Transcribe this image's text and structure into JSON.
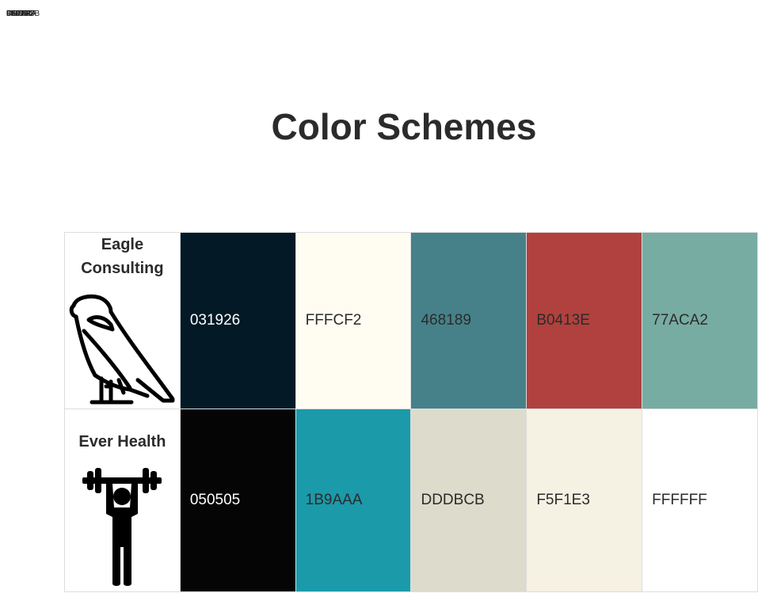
{
  "header_labels": [
    "F5F1E3",
    "FFFFFF",
    "DDDBCB",
    "1B9AAA",
    "050505",
    "031926"
  ],
  "title": "Color Schemes",
  "schemes": [
    {
      "name": "Eagle Consulting",
      "logo_icon": "eagle-icon",
      "colors": [
        {
          "hex": "031926",
          "bg": "#031926",
          "text_color": "#ffffff"
        },
        {
          "hex": "FFFCF2",
          "bg": "#FFFCF2",
          "text_color": "#2b2b2b"
        },
        {
          "hex": "468189",
          "bg": "#468189",
          "text_color": "#2b2b2b"
        },
        {
          "hex": "B0413E",
          "bg": "#B0413E",
          "text_color": "#2b2b2b"
        },
        {
          "hex": "77ACA2",
          "bg": "#77ACA2",
          "text_color": "#2b2b2b"
        }
      ]
    },
    {
      "name": "Ever Health",
      "logo_icon": "weightlifter-icon",
      "colors": [
        {
          "hex": "050505",
          "bg": "#050505",
          "text_color": "#ffffff"
        },
        {
          "hex": "1B9AAA",
          "bg": "#1B9AAA",
          "text_color": "#2b2b2b"
        },
        {
          "hex": "DDDBCB",
          "bg": "#DDDBCB",
          "text_color": "#2b2b2b"
        },
        {
          "hex": "F5F1E3",
          "bg": "#F5F1E3",
          "text_color": "#2b2b2b"
        },
        {
          "hex": "FFFFFF",
          "bg": "#FFFFFF",
          "text_color": "#2b2b2b"
        }
      ]
    }
  ]
}
